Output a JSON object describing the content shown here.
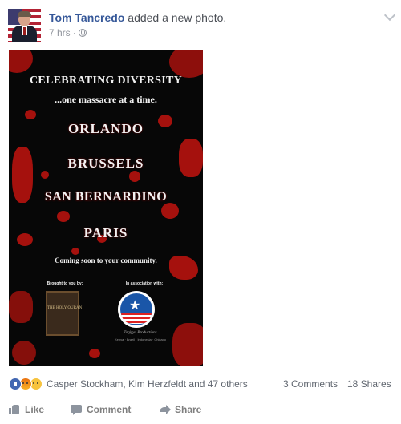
{
  "post": {
    "author": "Tom Tancredo",
    "action": "added a new photo.",
    "time": "7 hrs",
    "separator": "·",
    "privacy_icon": "globe-icon",
    "menu_icon": "chevron-down-icon"
  },
  "poster": {
    "title": "CELEBRATING DIVERSITY",
    "subtitle": "...one massacre at a time.",
    "cities": [
      "ORLANDO",
      "BRUSSELS",
      "SAN BERNARDINO",
      "PARIS"
    ],
    "tagline": "Coming soon to your community.",
    "brought_by": "Brought to you by:",
    "book_title": "THE HOLY QURAN",
    "association": "In association with:",
    "production": "Taqiyya Productions",
    "production_cities": "Kenya · Brazil · Indonesia · Chicago"
  },
  "engagement": {
    "reaction_icons": [
      "like-reaction-icon",
      "angry-reaction-icon",
      "sad-reaction-icon"
    ],
    "reactors": "Casper Stockham, Kim Herzfeldt and 47 others",
    "comments": "3 Comments",
    "shares": "18 Shares"
  },
  "actions": {
    "like": "Like",
    "comment": "Comment",
    "share": "Share"
  },
  "colors": {
    "link": "#365899",
    "muted": "#90949c",
    "blood": "#a5110d",
    "poster_bg": "#070707"
  }
}
